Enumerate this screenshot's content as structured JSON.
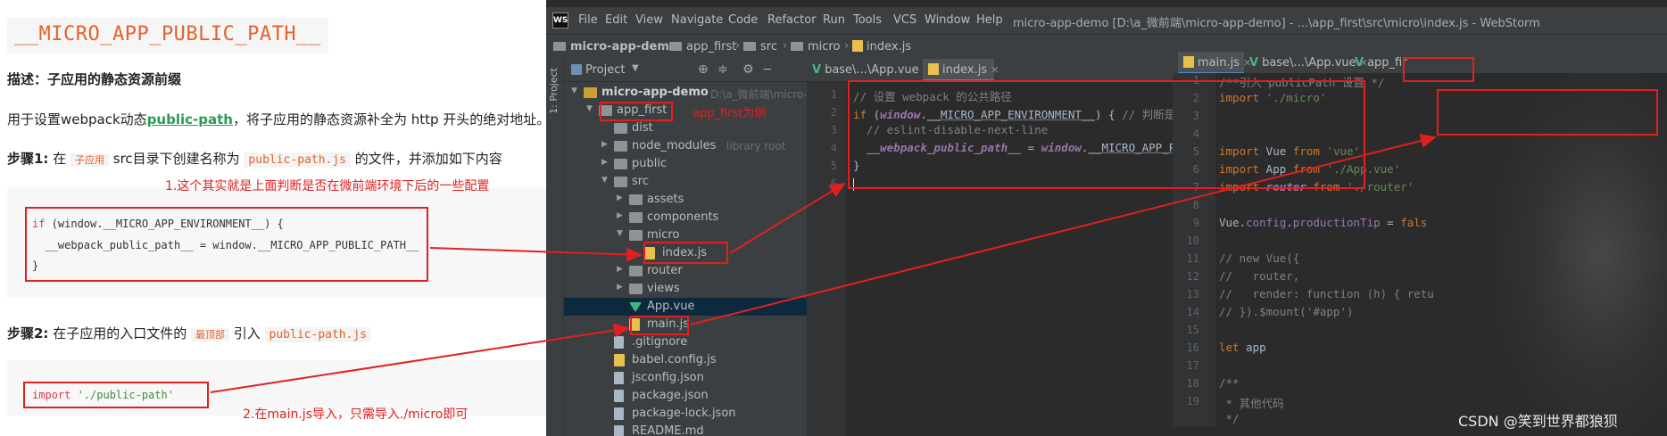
{
  "doc": {
    "heading": "__MICRO_APP_PUBLIC_PATH__",
    "desc_label": "描述：",
    "desc_text": "子应用的静态资源前缀",
    "usage_before": "用于设置webpack动态",
    "usage_link": "public-path",
    "usage_after": "，将子应用的静态资源补全为 http 开头的绝对地址。",
    "step1_label": "步骤1:",
    "step1_a": " 在 ",
    "step1_chip": "子应用",
    "step1_b": " src目录下创建名称为 ",
    "step1_file": "public-path.js",
    "step1_c": " 的文件，并添加如下内容",
    "annot1": "1.这个其实就是上面判断是否在微前端环境下后的一些配置",
    "code1_l1_kw": "if",
    "code1_l1_rest": " (window.__MICRO_APP_ENVIRONMENT__) {",
    "code1_l2": "  __webpack_public_path__ = window.__MICRO_APP_PUBLIC_PATH__",
    "code1_l3": "}",
    "step2_label": "步骤2:",
    "step2_a": " 在子应用的入口文件的 ",
    "step2_chip": "最顶部",
    "step2_b": " 引入 ",
    "step2_file": "public-path.js",
    "code2_kw": "import",
    "code2_str": " './public-path'",
    "annot2": "2.在main.js导入，只需导入./micro即可"
  },
  "ide": {
    "logo": "WS",
    "menus": [
      "File",
      "Edit",
      "View",
      "Navigate",
      "Code",
      "Refactor",
      "Run",
      "Tools",
      "VCS",
      "Window",
      "Help"
    ],
    "window_title": "micro-app-demo [D:\\a_微前端\\micro-app-demo] - ...\\app_first\\src\\micro\\index.js - WebStorm",
    "breadcrumbs": [
      "micro-app-demo",
      "app_first",
      "src",
      "micro",
      "index.js"
    ],
    "side_strip_label": "1: Project",
    "project_panel_title": "Project",
    "tree": [
      {
        "label": "micro-app-demo",
        "hint": "D:\\a_微前端\\micro-app",
        "level": 0,
        "kind": "mod",
        "open": true,
        "bold": true
      },
      {
        "label": "app_first",
        "hint": "",
        "level": 1,
        "kind": "folder",
        "open": true
      },
      {
        "label": "dist",
        "hint": "",
        "level": 2,
        "kind": "folder",
        "open": null
      },
      {
        "label": "node_modules",
        "hint": "library root",
        "level": 2,
        "kind": "folder",
        "open": false
      },
      {
        "label": "public",
        "hint": "",
        "level": 2,
        "kind": "folder",
        "open": false
      },
      {
        "label": "src",
        "hint": "",
        "level": 2,
        "kind": "folder",
        "open": true
      },
      {
        "label": "assets",
        "hint": "",
        "level": 3,
        "kind": "folder",
        "open": false
      },
      {
        "label": "components",
        "hint": "",
        "level": 3,
        "kind": "folder",
        "open": false
      },
      {
        "label": "micro",
        "hint": "",
        "level": 3,
        "kind": "folder",
        "open": true
      },
      {
        "label": "index.js",
        "hint": "",
        "level": 4,
        "kind": "js",
        "open": null
      },
      {
        "label": "router",
        "hint": "",
        "level": 3,
        "kind": "folder",
        "open": false
      },
      {
        "label": "views",
        "hint": "",
        "level": 3,
        "kind": "folder",
        "open": false
      },
      {
        "label": "App.vue",
        "hint": "",
        "level": 3,
        "kind": "vue",
        "open": null,
        "selected": true
      },
      {
        "label": "main.js",
        "hint": "",
        "level": 3,
        "kind": "js",
        "open": null
      },
      {
        "label": ".gitignore",
        "hint": "",
        "level": 2,
        "kind": "cfg",
        "open": null
      },
      {
        "label": "babel.config.js",
        "hint": "",
        "level": 2,
        "kind": "js",
        "open": null
      },
      {
        "label": "jsconfig.json",
        "hint": "",
        "level": 2,
        "kind": "cfg",
        "open": null
      },
      {
        "label": "package.json",
        "hint": "",
        "level": 2,
        "kind": "cfg",
        "open": null
      },
      {
        "label": "package-lock.json",
        "hint": "",
        "level": 2,
        "kind": "cfg",
        "open": null
      },
      {
        "label": "README.md",
        "hint": "",
        "level": 2,
        "kind": "cfg",
        "open": null
      }
    ],
    "annot_app_first": "app_first为例",
    "editor1": {
      "tabs": [
        {
          "label": "base\\...\\App.vue",
          "kind": "vue",
          "active": false
        },
        {
          "label": "index.js",
          "kind": "js",
          "active": true
        }
      ],
      "line_numbers": [
        "1",
        "2",
        "3",
        "4",
        "5",
        "6"
      ],
      "l1": "// 设置 webpack 的公共路径",
      "l2_kw": "if",
      "l2_a": " (",
      "l2_glob": "window",
      "l2_b": ".",
      "l2_prop": "__MICRO_APP_ENVIRONMENT__",
      "l2_c": ") { ",
      "l2_com": "// 判断是否在微前端环境中",
      "l3": "  // eslint-disable-next-line",
      "l4_glob1": "__webpack_public_path__",
      "l4_a": " = ",
      "l4_glob2": "window",
      "l4_b": ".",
      "l4_prop": "__MICRO_APP_PUBLIC_PATH__",
      "l4_c": " || ",
      "l4_str": "'/'",
      "l5": "}"
    },
    "editor2": {
      "tabs": [
        {
          "label": "main.js",
          "kind": "js",
          "active": true
        },
        {
          "label": "base\\...\\App.vue",
          "kind": "vue",
          "active": false
        },
        {
          "label": "app_fir",
          "kind": "vue",
          "active": false
        }
      ],
      "line_numbers": [
        "1",
        "2",
        "3",
        "4",
        "5",
        "6",
        "7",
        "8",
        "9",
        "10",
        "11",
        "12",
        "13",
        "14",
        "15",
        "16",
        "17",
        "18",
        "19"
      ],
      "l1": "/**引入 publicPath 设置 */",
      "l2_kw": "import",
      "l2_str": " './micro'",
      "l4_kw": "import",
      "l4_a": " Vue ",
      "l4_kw2": "from",
      "l4_str": " 'vue'",
      "l5_kw": "import",
      "l5_a": " App ",
      "l5_kw2": "from",
      "l5_str": " './App.vue'",
      "l6_kw": "import",
      "l6_glob": " router",
      "l6_kw2": " from",
      "l6_str": " './router'",
      "l8_a": "Vue.",
      "l8_prop": "config",
      "l8_b": ".",
      "l8_prop2": "productionTip",
      "l8_c": " = ",
      "l8_kw": "fals",
      "l10": "// new Vue({",
      "l11": "//   router,",
      "l12": "//   render: function (h) { retu",
      "l13": "// }).$mount('#app')",
      "l15_kw": "let",
      "l15_a": " app",
      "l17": "/**",
      "l18": " * 其他代码",
      "l19": " */"
    },
    "watermark": "CSDN @笑到世界都狼狈"
  },
  "colors": {
    "annotation_red": "#e02020",
    "heading_orange": "#e3622b",
    "link_green": "#2c9b54",
    "ide_bg": "#2b2b2b",
    "panel_bg": "#3c3f41"
  }
}
